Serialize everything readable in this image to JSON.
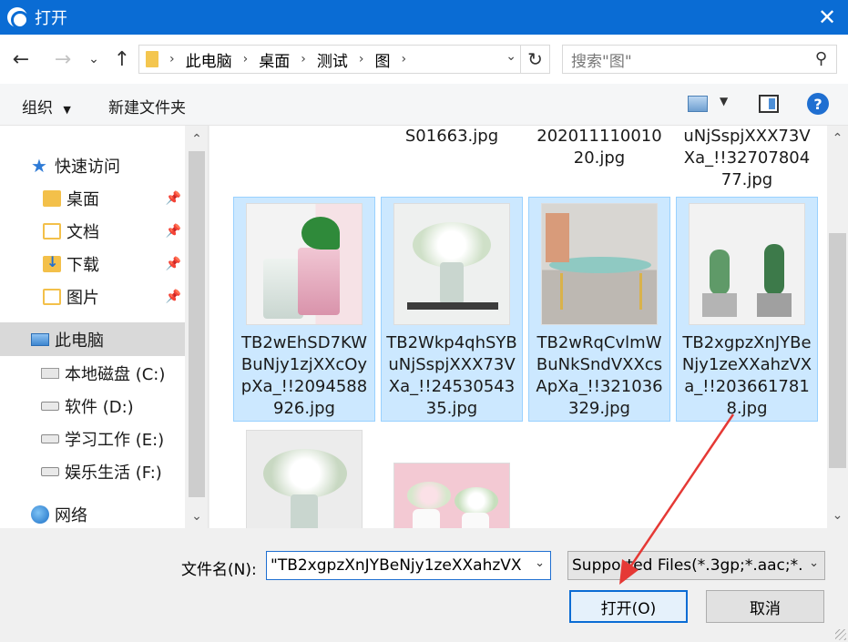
{
  "window": {
    "title": "打开"
  },
  "address": {
    "breadcrumbs": [
      "此电脑",
      "桌面",
      "测试",
      "图"
    ],
    "search_placeholder": "搜索\"图\""
  },
  "toolbar": {
    "organize": "组织",
    "new_folder": "新建文件夹"
  },
  "sidebar": {
    "quick_access": "快速访问",
    "items": [
      {
        "label": "桌面",
        "icon": "folder-icon",
        "pinned": true
      },
      {
        "label": "文档",
        "icon": "document-icon",
        "pinned": true
      },
      {
        "label": "下载",
        "icon": "download-icon",
        "pinned": true
      },
      {
        "label": "图片",
        "icon": "pictures-icon",
        "pinned": true
      }
    ],
    "this_pc": "此电脑",
    "drives": [
      {
        "label": "本地磁盘 (C:)"
      },
      {
        "label": "软件 (D:)"
      },
      {
        "label": "学习工作 (E:)"
      },
      {
        "label": "娱乐生活 (F:)"
      }
    ],
    "network": "网络"
  },
  "files": {
    "top_row_partial": [
      "S01663.jpg",
      "20201111001020.jpg",
      "uNjSspjXXX73VXa_!!3270780477.jpg"
    ],
    "top_row_display": [
      [
        "S01663.jpg"
      ],
      [
        "202011110010",
        "20.jpg"
      ],
      [
        "uNjSspjXXX73V",
        "Xa_!!32707804",
        "77.jpg"
      ]
    ],
    "selected": [
      {
        "lines": [
          "TB2wEhSD7KW",
          "BuNjy1zjXXcOy",
          "pXa_!!2094588",
          "926.jpg"
        ]
      },
      {
        "lines": [
          "TB2Wkp4qhSYB",
          "uNjSspjXXX73V",
          "Xa_!!24530543",
          "35.jpg"
        ]
      },
      {
        "lines": [
          "TB2wRqCvlmW",
          "BuNkSndVXXcs",
          "ApXa_!!321036",
          "329.jpg"
        ]
      },
      {
        "lines": [
          "TB2xgpzXnJYBe",
          "Njy1zeXXahzVX",
          "a_!!203661781",
          "8.jpg"
        ]
      }
    ]
  },
  "bottom": {
    "filename_label": "文件名(N):",
    "filename_value": "\"TB2xgpzXnJYBeNjy1zeXXahzVX",
    "filter_value": "Supported Files(*.3gp;*.aac;*.",
    "open_button": "打开(O)",
    "cancel_button": "取消"
  },
  "colors": {
    "titlebar": "#0a6cd4",
    "selection_fill": "#cce8ff",
    "selection_border": "#99d1ff",
    "annotation_arrow": "#e53935"
  }
}
